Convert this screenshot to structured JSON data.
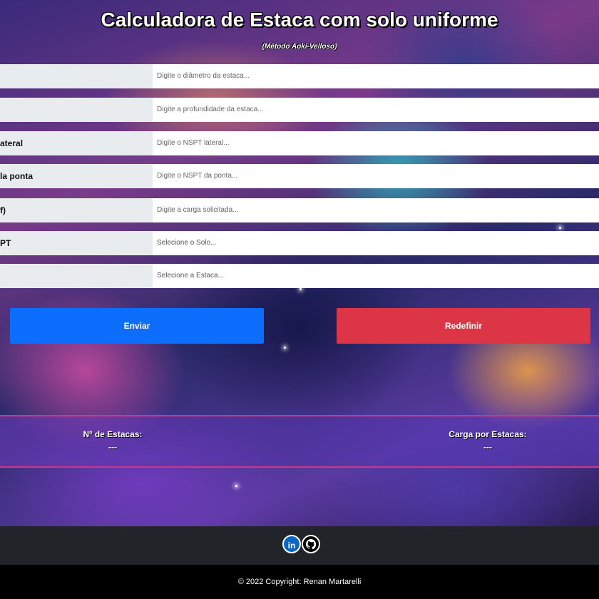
{
  "header": {
    "title": "Calculadora de Estaca com solo uniforme",
    "subtitle": "(Método Aoki-Velloso)"
  },
  "form": {
    "fields": [
      {
        "label": "",
        "placeholder": "Digite o diâmetro da estaca..."
      },
      {
        "label": "",
        "placeholder": "Digite a profundidade da estaca..."
      },
      {
        "label": "ateral",
        "placeholder": "Digite o NSPT lateral..."
      },
      {
        "label": "la ponta",
        "placeholder": "Digite o NSPT da ponta..."
      },
      {
        "label": "f)",
        "placeholder": "Digite a carga solicitada..."
      },
      {
        "label": "PT",
        "placeholder": "Selecione o Solo..."
      },
      {
        "label": "",
        "placeholder": "Selecione a Estaca..."
      }
    ],
    "submit_label": "Enviar",
    "reset_label": "Redefinir"
  },
  "results": {
    "piles_label": "Nº de Estacas:",
    "piles_value": "---",
    "load_label": "Carga por Estacas:",
    "load_value": "---"
  },
  "footer": {
    "icons": [
      "linkedin-icon",
      "github-icon"
    ],
    "copyright": "© 2022 Copyright: Renan Martarelli"
  },
  "colors": {
    "submit": "#0d6efd",
    "reset": "#dc3545",
    "result_border": "#d63384",
    "footer_bg": "#212529"
  }
}
